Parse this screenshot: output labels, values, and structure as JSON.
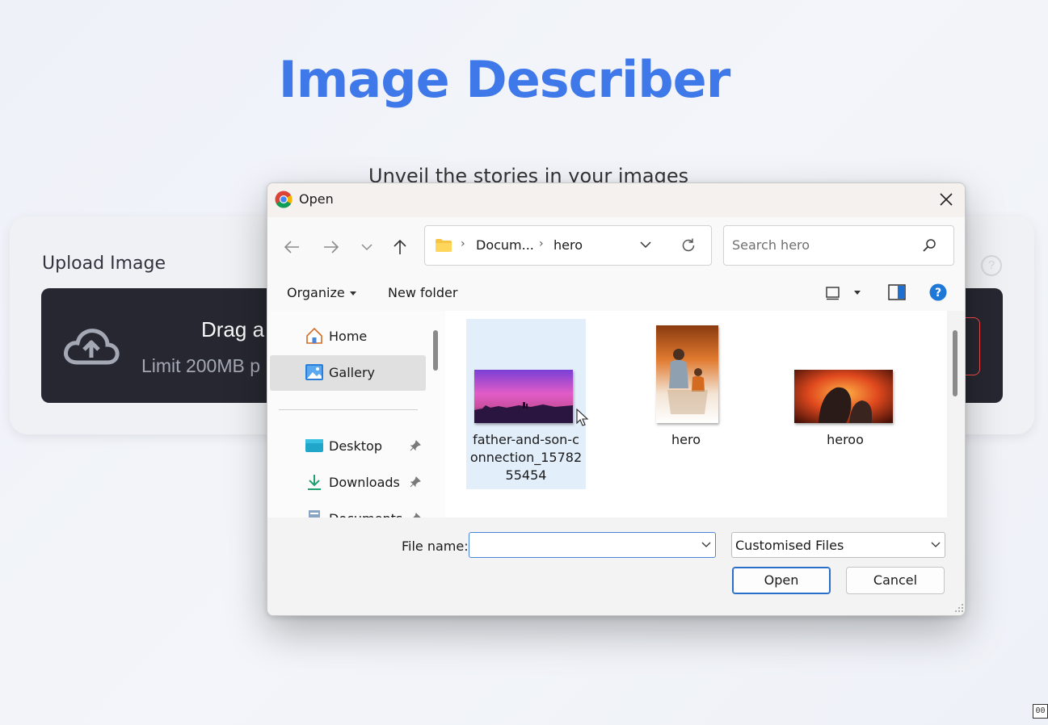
{
  "background_page": {
    "title": "Image Describer",
    "subtitle": "Unveil the stories in your images",
    "upload_label": "Upload Image",
    "help_icon": "question-circle-icon",
    "dropzone_text": "Drag a",
    "dropzone_limit": "Limit 200MB p",
    "cloud_icon": "cloud-upload-icon",
    "accent_color": "#3f78e8"
  },
  "corner_box_text": "00",
  "dialog": {
    "title": "Open",
    "app_icon": "chrome-icon",
    "nav": {
      "back_icon": "arrow-left-icon",
      "forward_icon": "arrow-right-icon",
      "recent_icon": "chevron-down-icon",
      "up_icon": "arrow-up-icon"
    },
    "address": {
      "breadcrumbs": [
        "Docum...",
        "hero"
      ]
    },
    "search": {
      "placeholder": "Search hero"
    },
    "commands": {
      "organize": "Organize",
      "new_folder": "New folder"
    },
    "nav_pane": [
      {
        "label": "Home",
        "icon": "home-icon",
        "selected": false
      },
      {
        "label": "Gallery",
        "icon": "gallery-icon",
        "selected": true
      },
      {
        "label": "Desktop",
        "icon": "desktop-icon",
        "pinned": true
      },
      {
        "label": "Downloads",
        "icon": "download-icon",
        "pinned": true
      },
      {
        "label": "Documents",
        "icon": "documents-icon",
        "pinned": true
      }
    ],
    "files": [
      {
        "name_lines": [
          "father-and-son-c",
          "onnection_15782",
          "55454"
        ],
        "selected": true
      },
      {
        "name_lines": [
          "hero"
        ],
        "selected": false
      },
      {
        "name_lines": [
          "heroo"
        ],
        "selected": false
      }
    ],
    "file_name_label": "File name:",
    "file_name_value": "",
    "file_type": "Customised Files",
    "open_label": "Open",
    "cancel_label": "Cancel"
  }
}
